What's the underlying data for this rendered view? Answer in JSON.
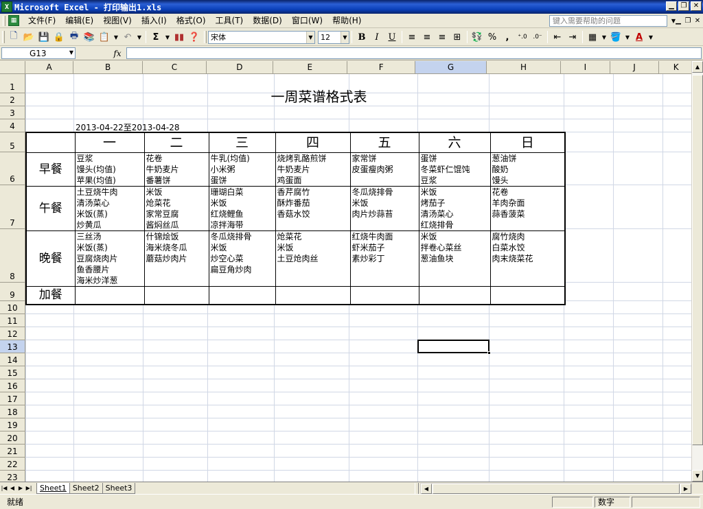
{
  "window": {
    "title": "Microsoft Excel - 打印输出1.xls",
    "app_icon_label": "X"
  },
  "menubar": {
    "items": [
      "文件(F)",
      "编辑(E)",
      "视图(V)",
      "插入(I)",
      "格式(O)",
      "工具(T)",
      "数据(D)",
      "窗口(W)",
      "帮助(H)"
    ],
    "help_placeholder": "键入需要帮助的问题"
  },
  "toolbar": {
    "font_name": "宋体",
    "font_size": "12",
    "bold": "B",
    "italic": "I",
    "underline": "U",
    "percent": "%",
    "comma": ",",
    "sigma": "Σ"
  },
  "formula_bar": {
    "cell_ref": "G13",
    "fx_label": "fx",
    "value": ""
  },
  "columns": [
    "A",
    "B",
    "C",
    "D",
    "E",
    "F",
    "G",
    "H",
    "I",
    "J",
    "K"
  ],
  "selected_column": "G",
  "rows": [
    "1",
    "2",
    "3",
    "4",
    "5",
    "6",
    "7",
    "8",
    "9",
    "10",
    "11",
    "12",
    "13",
    "14",
    "15",
    "16",
    "17",
    "18",
    "19",
    "20",
    "21",
    "22",
    "23"
  ],
  "selected_row": "13",
  "sheet": {
    "title": "一周菜谱格式表",
    "date_range": "2013-04-22至2013-04-28",
    "days": [
      "一",
      "二",
      "三",
      "四",
      "五",
      "六",
      "日"
    ],
    "meals": [
      {
        "name": "早餐",
        "dishes": [
          [
            "豆浆",
            "馒头(均值)",
            "苹果(均值)"
          ],
          [
            "花卷",
            "牛奶麦片",
            "番薯饼"
          ],
          [
            "牛乳(均值)",
            "小米粥",
            "蛋饼"
          ],
          [
            "烧烤乳酪煎饼",
            "牛奶麦片",
            "鸡蛋面"
          ],
          [
            "家常饼",
            "皮蛋瘦肉粥"
          ],
          [
            "蛋饼",
            "冬菜虾仁馄饨",
            "豆浆"
          ],
          [
            "葱油饼",
            "酸奶",
            "馒头"
          ]
        ]
      },
      {
        "name": "午餐",
        "dishes": [
          [
            "土豆烧牛肉",
            "清汤菜心",
            "米饭(蒸)",
            "炒黄瓜"
          ],
          [
            "米饭",
            "炝菜花",
            "家常豆腐",
            "酱焖丝瓜"
          ],
          [
            "珊瑚白菜",
            "米饭",
            "红烧鲤鱼",
            "凉拌海带"
          ],
          [
            "香芹腐竹",
            "酥炸番茄",
            "香菇水饺"
          ],
          [
            "冬瓜烧排骨",
            "米饭",
            "肉片炒蒜苔"
          ],
          [
            "米饭",
            "烤茄子",
            "清汤菜心",
            "红烧排骨"
          ],
          [
            "花卷",
            "羊肉杂面",
            "蒜香菠菜"
          ]
        ]
      },
      {
        "name": "晚餐",
        "dishes": [
          [
            "三丝汤",
            "米饭(蒸)",
            "豆腐烧肉片",
            "鱼香腰片",
            "海米炒洋葱"
          ],
          [
            "什锦烩饭",
            "海米烧冬瓜",
            "蘑菇炒肉片"
          ],
          [
            "冬瓜烧排骨",
            "米饭",
            "炒空心菜",
            "扁豆角炒肉"
          ],
          [
            "炝菜花",
            "米饭",
            "土豆炝肉丝"
          ],
          [
            "红烧牛肉面",
            "虾米茄子",
            "素炒彩丁"
          ],
          [
            "米饭",
            "拌卷心菜丝",
            "葱油鱼块"
          ],
          [
            "腐竹烧肉",
            "白菜水饺",
            "肉末烧菜花"
          ]
        ]
      },
      {
        "name": "加餐",
        "dishes": [
          [],
          [],
          [],
          [],
          [],
          [],
          []
        ]
      }
    ]
  },
  "sheet_tabs": [
    "Sheet1",
    "Sheet2",
    "Sheet3"
  ],
  "active_tab": "Sheet1",
  "status": {
    "ready": "就绪",
    "num_indicator": "数字"
  }
}
